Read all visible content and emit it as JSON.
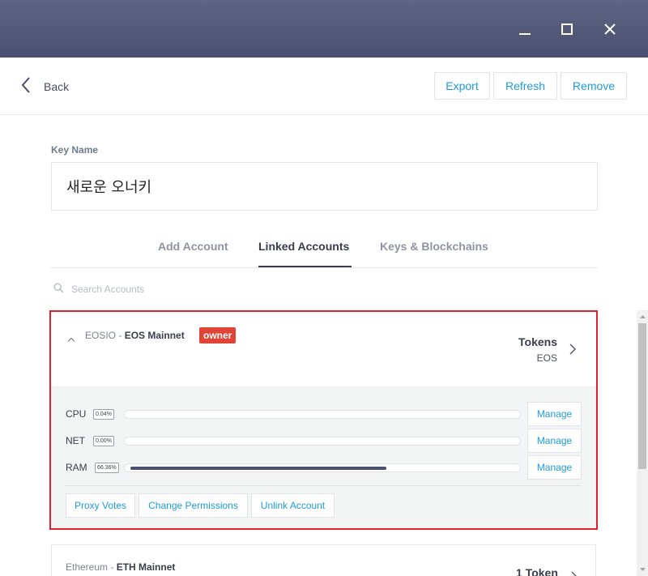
{
  "window": {
    "controls": [
      "minimize-icon",
      "maximize-icon",
      "close-icon"
    ]
  },
  "toolbar": {
    "back_label": "Back",
    "export_label": "Export",
    "refresh_label": "Refresh",
    "remove_label": "Remove"
  },
  "key": {
    "label": "Key Name",
    "value": "새로운 오너키"
  },
  "tabs": [
    {
      "label": "Add Account",
      "active": false
    },
    {
      "label": "Linked Accounts",
      "active": true
    },
    {
      "label": "Keys & Blockchains",
      "active": false
    }
  ],
  "search": {
    "placeholder": "Search Accounts"
  },
  "accounts": [
    {
      "blockchain": "EOSIO",
      "separator": " - ",
      "network": "EOS Mainnet",
      "badge": "owner",
      "tokens_title": "Tokens",
      "tokens_sub": "EOS",
      "expanded": true,
      "resources": [
        {
          "name": "CPU",
          "percent_label": "0.04%",
          "fraction": 0.0004,
          "manage_label": "Manage"
        },
        {
          "name": "NET",
          "percent_label": "0.00%",
          "fraction": 0.0,
          "manage_label": "Manage"
        },
        {
          "name": "RAM",
          "percent_label": "66.36%",
          "fraction": 0.6636,
          "manage_label": "Manage"
        }
      ],
      "actions": {
        "proxy_votes": "Proxy Votes",
        "change_permissions": "Change Permissions",
        "unlink_account": "Unlink Account"
      }
    },
    {
      "blockchain": "Ethereum",
      "separator": " - ",
      "network": "ETH Mainnet",
      "tokens_title": "1 Token",
      "expanded": false
    }
  ],
  "colors": {
    "titlebar": "#4b5070",
    "accent_blue": "#1e9ce0",
    "badge_red": "#e04437",
    "highlight_red": "#e0202a"
  }
}
